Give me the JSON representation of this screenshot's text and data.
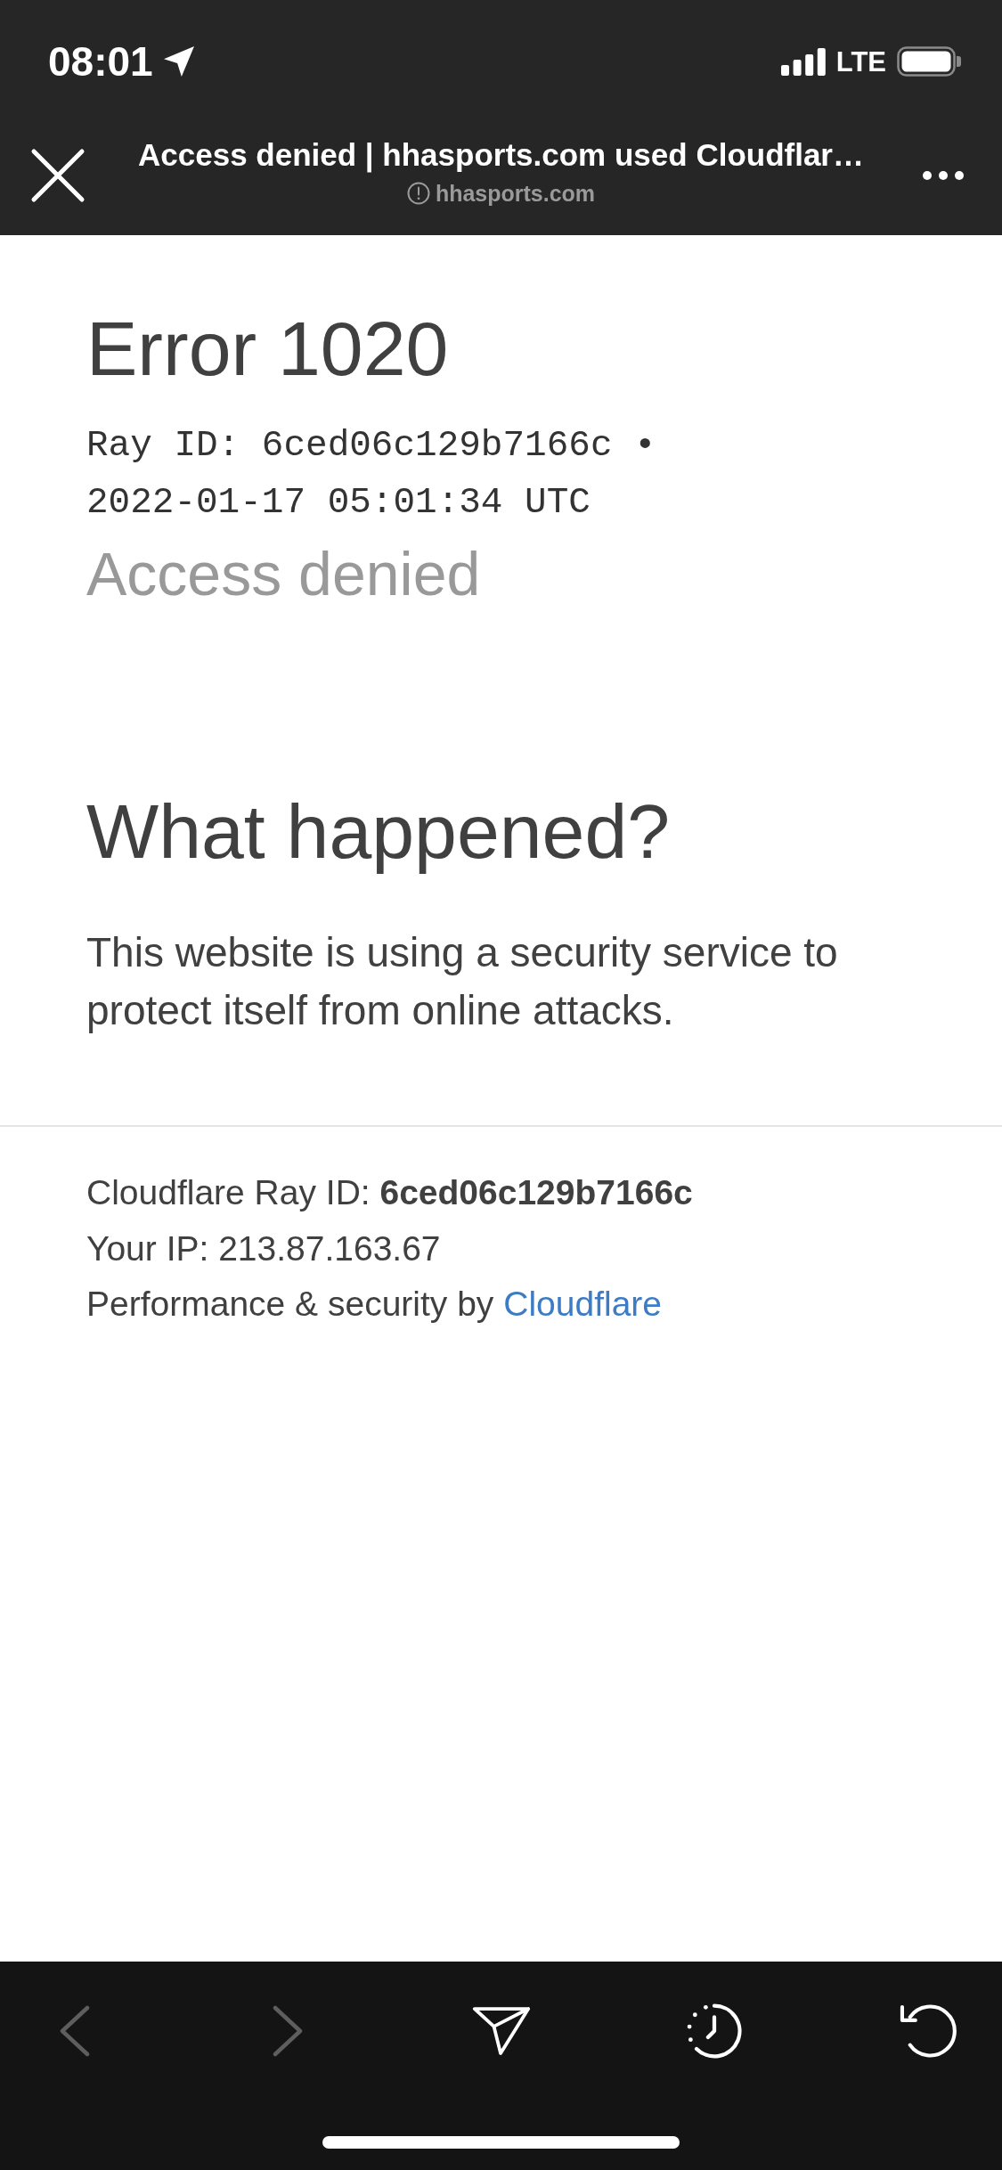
{
  "status_bar": {
    "time": "08:01",
    "network": "LTE"
  },
  "browser_bar": {
    "title": "Access denied | hhasports.com used Cloudflar…",
    "url": "hhasports.com"
  },
  "error": {
    "code": "Error 1020",
    "ray_info": "Ray ID: 6ced06c129b7166c • 2022-01-17 05:01:34 UTC",
    "status": "Access denied"
  },
  "explanation": {
    "heading": "What happened?",
    "text": "This website is using a security service to protect itself from online attacks."
  },
  "footer": {
    "ray_id": "Cloudflare Ray ID: **6ced06c129b7166c**",
    "ip": "Your IP: 213.87.163.67",
    "attribution": {
      "text": "Performance & security by",
      "link": "Cloudflare"
    }
  },
  "toolbar": [
    {
      "kind": "back",
      "disabled": true
    },
    {
      "kind": "forward",
      "disabled": true
    },
    {
      "kind": "share",
      "disabled": false
    },
    {
      "kind": "history",
      "disabled": false
    },
    {
      "kind": "reload",
      "disabled": false
    }
  ]
}
